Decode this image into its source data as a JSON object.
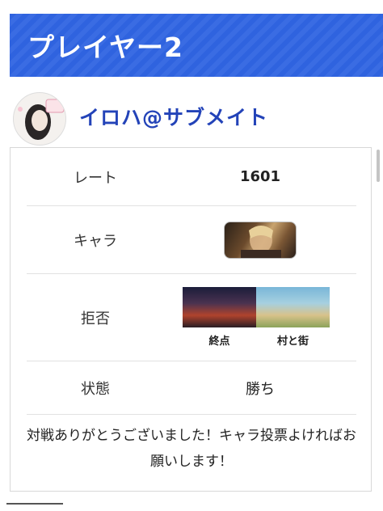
{
  "header": {
    "title": "プレイヤー2"
  },
  "player": {
    "name": "イロハ@サブメイト"
  },
  "stats": {
    "rate_label": "レート",
    "rate_value": "1601",
    "chara_label": "キャラ",
    "ban_label": "拒否",
    "status_label": "状態",
    "status_value": "勝ち"
  },
  "banned_stages": [
    {
      "name": "終点"
    },
    {
      "name": "村と街"
    }
  ],
  "comment": "対戦ありがとうございました！キャラ投票よければお願いします！",
  "colors": {
    "header_bg": "#2f63df",
    "name_color": "#2343b8"
  }
}
